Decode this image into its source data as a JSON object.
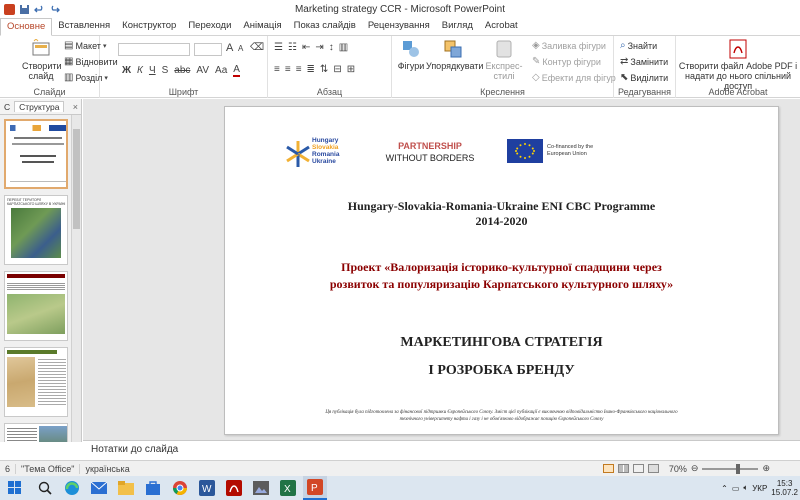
{
  "window": {
    "title": "Marketing strategy CCR  -  Microsoft PowerPoint"
  },
  "tabs": [
    "Основне",
    "Вставлення",
    "Конструктор",
    "Переходи",
    "Анімація",
    "Показ слайдів",
    "Рецензування",
    "Вигляд",
    "Acrobat"
  ],
  "ribbon": {
    "slides": {
      "new_slide": "Створити слайд",
      "layout": "Макет",
      "reset": "Відновити",
      "section": "Розділ",
      "label": "Слайди"
    },
    "font": {
      "label": "Шрифт",
      "size_up": "A",
      "size_down": "A"
    },
    "paragraph": {
      "label": "Абзац"
    },
    "drawing": {
      "shapes": "Фігури",
      "arrange": "Упорядкувати",
      "quick_styles": "Експрес-стилі",
      "fill": "Заливка фігури",
      "outline": "Контур фігури",
      "effects": "Ефекти для фігур",
      "label": "Креслення"
    },
    "editing": {
      "find": "Знайти",
      "replace": "Замінити",
      "select": "Виділити",
      "label": "Редагування"
    },
    "acrobat": {
      "create_pdf_line1": "Створити файл Adobe PDF і",
      "create_pdf_line2": "надати до нього спільний доступ",
      "label": "Adobe Acrobat"
    }
  },
  "left_panel": {
    "tab_slides": "С",
    "tab_outline": "Структура",
    "close": "×",
    "thumb_numbers": [
      "",
      "",
      "",
      "",
      ""
    ],
    "thumb2_title": "ПЕРЕБІГ ТЕРИТОРІЇ КАРПАТСЬКОГО ШЛЯХУ В УКРАЇНІ"
  },
  "slide": {
    "partnership_1": "PARTNERSHIP",
    "partnership_2": "WITHOUT BORDERS",
    "logo_words": [
      "Hungary",
      "Slovakia",
      "Romania",
      "Ukraine"
    ],
    "eu_1": "Co-financed by the",
    "eu_2": "European Union",
    "programme_1": "Hungary-Slovakia-Romania-Ukraine ENI CBC Programme",
    "programme_2": "2014-2020",
    "project_1": "Проект «Валоризація історико-культурної спадщини через",
    "project_2": "розвиток та популяризацію Карпатського культурного шляху»",
    "title_1": "МАРКЕТИНГОВА СТРАТЕГІЯ",
    "title_2": "І РОЗРОБКА БРЕНДУ",
    "disclaimer_1": "Ця публікація була підготовлена за фінансової підтримки Європейського Союзу. Зміст цієї публікації є виключною відповідальністю Івано-Франківського національного",
    "disclaimer_2": "технічного університету нафти і газу і не обов'язково відображає позицію Європейського Союзу"
  },
  "notes": {
    "placeholder": "Нотатки до слайда"
  },
  "status": {
    "slide": "6",
    "theme": "\"Тема Office\"",
    "language": "українська",
    "zoom": "70%"
  },
  "taskbar": {
    "lang": "УКР",
    "time": "15:3",
    "date": "15.07.2"
  }
}
